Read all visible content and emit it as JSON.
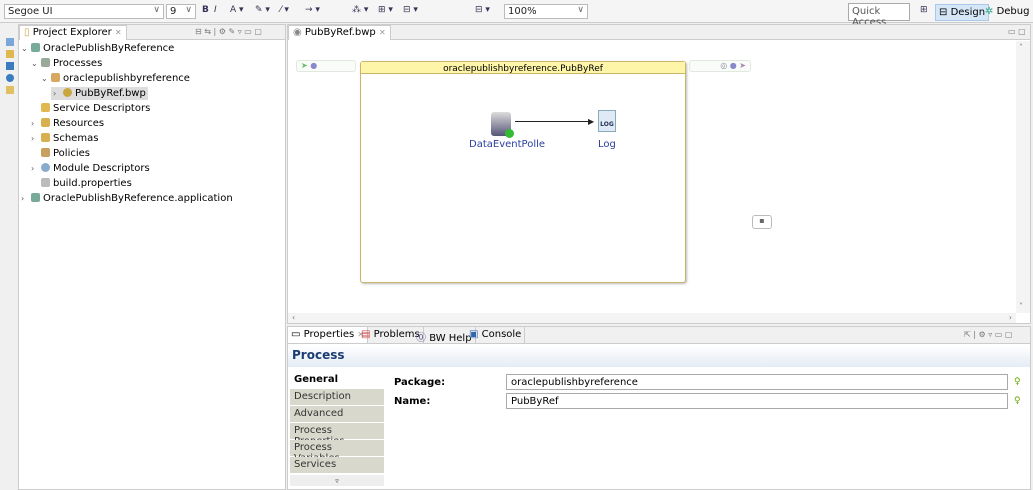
{
  "toolbar": {
    "font": "Segoe UI",
    "size": "9",
    "zoom": "100%",
    "quick_access": "Quick Access",
    "design": "Design",
    "debug": "Debug"
  },
  "explorer": {
    "title": "Project Explorer",
    "items": [
      {
        "label": "OraclePublishByReference"
      },
      {
        "label": "Processes"
      },
      {
        "label": "oraclepublishbyreference"
      },
      {
        "label": "PubByRef.bwp"
      },
      {
        "label": "Service Descriptors"
      },
      {
        "label": "Resources"
      },
      {
        "label": "Schemas"
      },
      {
        "label": "Policies"
      },
      {
        "label": "Module Descriptors"
      },
      {
        "label": "build.properties"
      },
      {
        "label": "OraclePublishByReference.application"
      }
    ]
  },
  "editor": {
    "tab": "PubByRef.bwp",
    "process_title": "oraclepublishbyreference.PubByRef",
    "activities": [
      "DataEventPolle",
      "Log"
    ],
    "log_badge": "LOG"
  },
  "properties": {
    "tabs": [
      "Properties",
      "Problems",
      "BW Help",
      "Console"
    ],
    "title": "Process",
    "sections": [
      "General",
      "Description",
      "Advanced",
      "Process Properties",
      "Process Variables",
      "Services"
    ],
    "package_label": "Package:",
    "package_value": "oraclepublishbyreference",
    "name_label": "Name:",
    "name_value": "PubByRef"
  }
}
